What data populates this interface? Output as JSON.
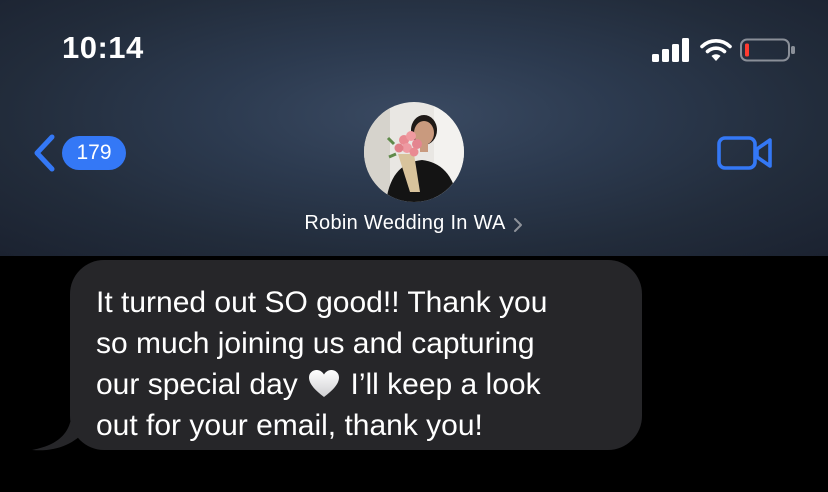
{
  "status_bar": {
    "time": "10:14",
    "signal_icon": "cellular-signal-icon",
    "wifi_icon": "wifi-icon",
    "battery_icon": "battery-low-icon",
    "battery_color": "#ff3b30"
  },
  "nav": {
    "back_icon": "chevron-left-icon",
    "unread_count": "179",
    "contact_name": "Robin Wedding In WA",
    "contact_chevron_icon": "chevron-right-icon",
    "video_icon": "video-camera-icon",
    "accent_color": "#3478f6"
  },
  "message": {
    "direction": "incoming",
    "lines": [
      "It turned out SO good!! Thank you",
      "so much joining us and capturing",
      "our special day",
      "I’ll keep a look",
      "out for your email, thank you!"
    ],
    "emoji": "white-heart-icon",
    "bubble_color": "#262629"
  }
}
